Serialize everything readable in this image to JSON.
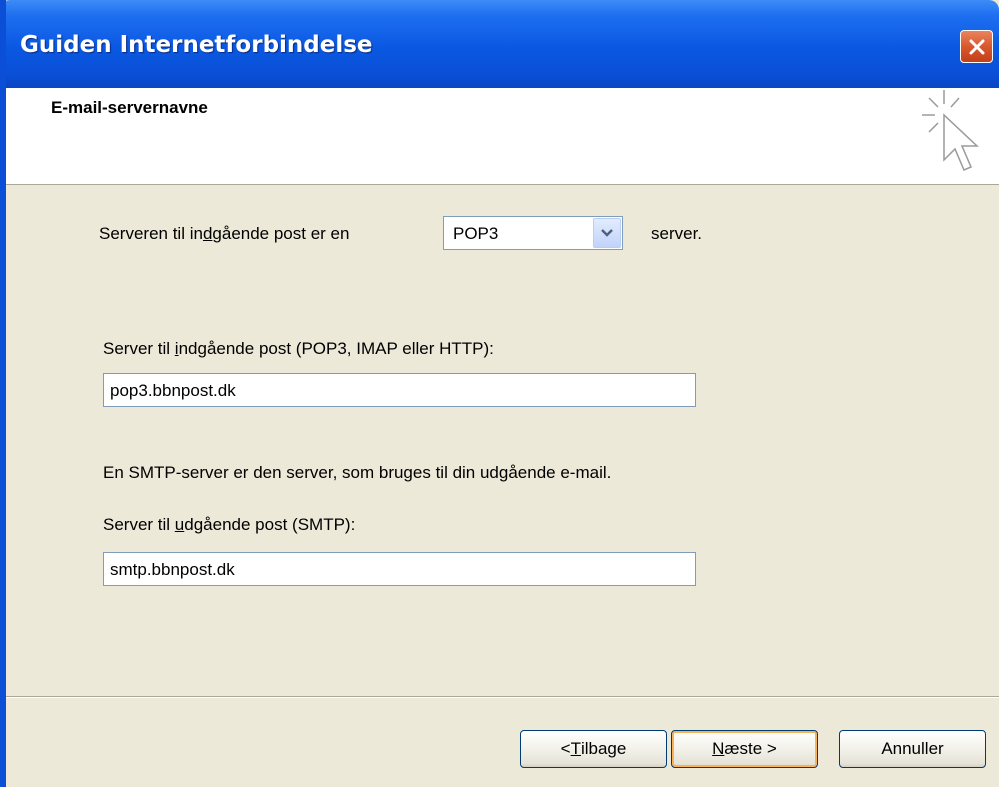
{
  "window": {
    "title": "Guiden Internetforbindelse"
  },
  "header": {
    "title": "E-mail-servernavne"
  },
  "incoming_type": {
    "label_pre": "Serveren til in",
    "label_accel": "d",
    "label_post": "gående post er en",
    "selected": "POP3",
    "suffix": "server."
  },
  "incoming_server": {
    "label_pre": "Server til ",
    "label_accel": "i",
    "label_post": "ndgående post (POP3, IMAP eller HTTP):",
    "value": "pop3.bbnpost.dk"
  },
  "smtp_info": "En SMTP-server er den server, som bruges til din udgående e-mail.",
  "outgoing_server": {
    "label_pre": "Server til ",
    "label_accel": "u",
    "label_post": "dgående post (SMTP):",
    "value": "smtp.bbnpost.dk"
  },
  "buttons": {
    "back_pre": "< ",
    "back_accel": "T",
    "back_post": "ilbage",
    "next_accel": "N",
    "next_post": "æste >",
    "cancel": "Annuller"
  },
  "colors": {
    "titlebar": "#0a58e2",
    "close": "#d8582e",
    "dialog_bg": "#ece9d8",
    "default_button_focus": "#f8b358"
  },
  "icons": {
    "close": "close-x-icon",
    "header": "sparkle-cursor-icon",
    "dropdown": "chevron-down-icon"
  }
}
